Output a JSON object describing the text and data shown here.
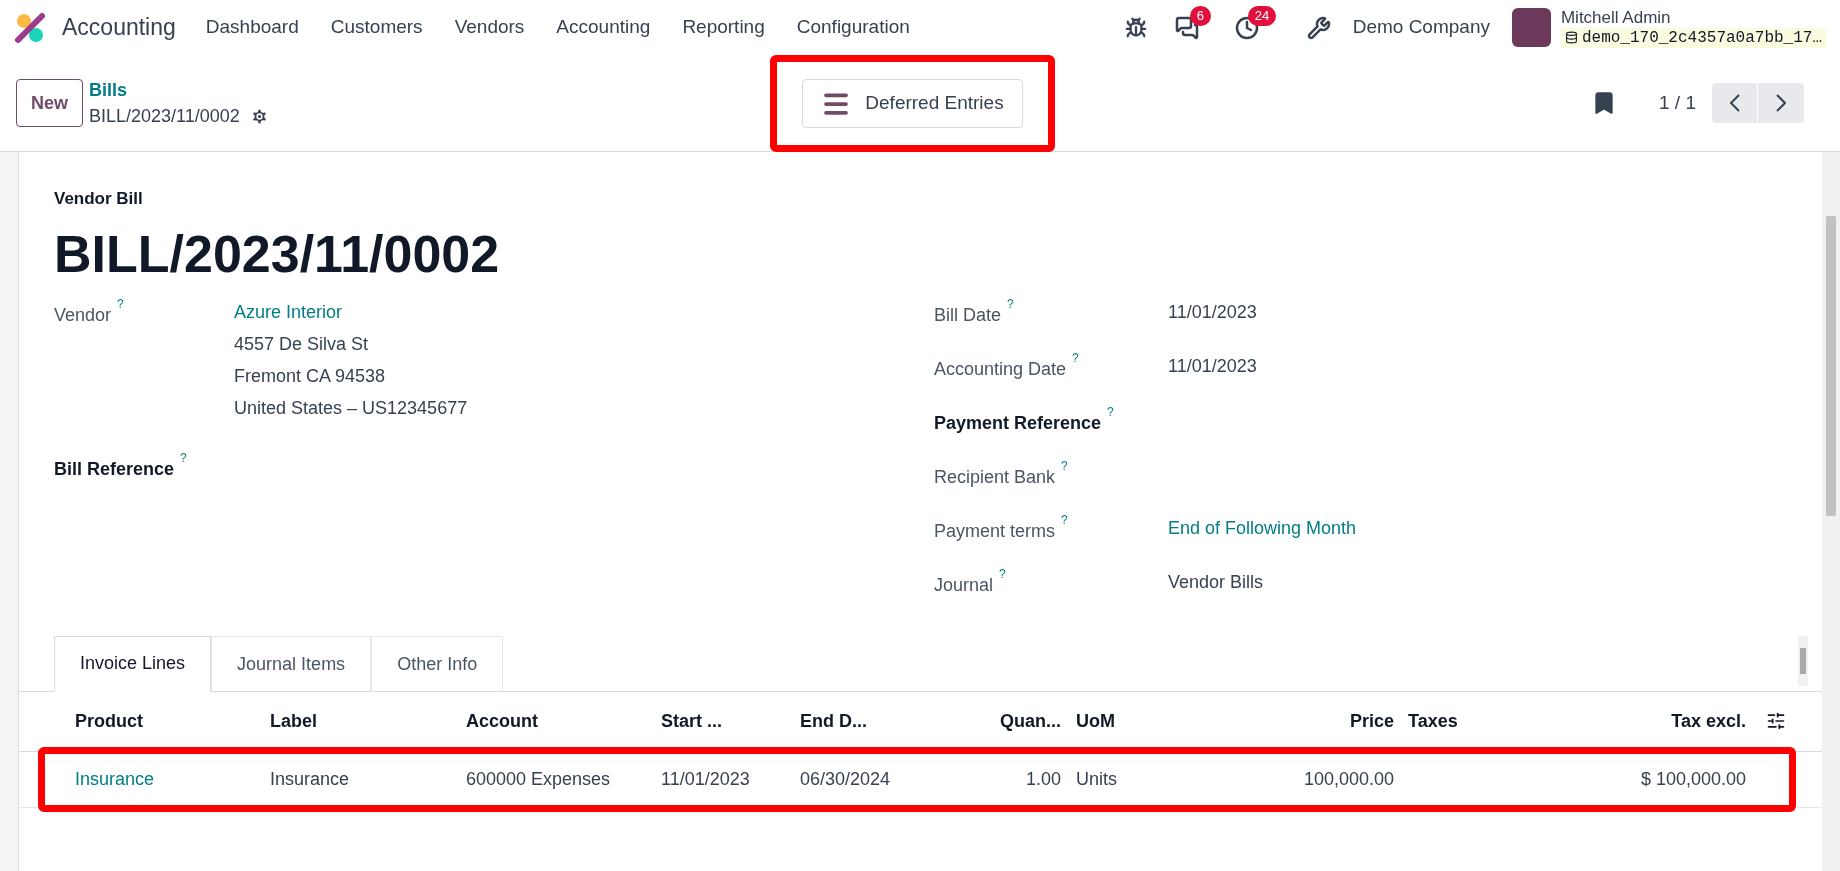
{
  "navbar": {
    "app_name": "Accounting",
    "menu": [
      "Dashboard",
      "Customers",
      "Vendors",
      "Accounting",
      "Reporting",
      "Configuration"
    ],
    "messages_count": "6",
    "activities_count": "24",
    "company": "Demo Company",
    "user_name": "Mitchell Admin",
    "database": "demo_170_2c4357a0a7bb_17…"
  },
  "control_panel": {
    "new_button": "New",
    "breadcrumb": "Bills",
    "record_name": "BILL/2023/11/0002",
    "action_button": {
      "label": "Deferred Entries",
      "highlighted": true
    },
    "pager": "1 / 1"
  },
  "form": {
    "subtitle": "Vendor Bill",
    "title": "BILL/2023/11/0002",
    "left_fields": [
      {
        "label": "Vendor",
        "help": "?",
        "bold": false,
        "kind": "link",
        "value": "Azure Interior",
        "lines": [
          "4557 De Silva St",
          "Fremont CA 94538",
          "United States – US12345677"
        ]
      },
      {
        "label": "Bill Reference",
        "help": "?",
        "bold": true,
        "kind": "empty"
      }
    ],
    "right_fields": [
      {
        "label": "Bill Date",
        "help": "?",
        "bold": false,
        "kind": "text",
        "value": "11/01/2023"
      },
      {
        "label": "Accounting Date",
        "help": "?",
        "bold": false,
        "kind": "text",
        "value": "11/01/2023"
      },
      {
        "label": "Payment Reference",
        "help": "?",
        "bold": true,
        "kind": "empty"
      },
      {
        "label": "Recipient Bank",
        "help": "?",
        "bold": false,
        "kind": "empty"
      },
      {
        "label": "Payment terms",
        "help": "?",
        "bold": false,
        "kind": "link",
        "value": "End of Following Month"
      },
      {
        "label": "Journal",
        "help": "?",
        "bold": false,
        "kind": "text",
        "value": "Vendor Bills"
      }
    ],
    "tabs": [
      {
        "label": "Invoice Lines",
        "selected": true
      },
      {
        "label": "Journal Items",
        "selected": false
      },
      {
        "label": "Other Info",
        "selected": false
      }
    ],
    "table": {
      "columns": [
        "Product",
        "Label",
        "Account",
        "Start ...",
        "End D...",
        "Quan...",
        "UoM",
        "Price",
        "Taxes",
        "Tax excl."
      ],
      "rows": [
        {
          "highlighted": true,
          "cells": [
            "Insurance",
            "Insurance",
            "600000 Expenses",
            "11/01/2023",
            "06/30/2024",
            "1.00",
            "Units",
            "100,000.00",
            "",
            "$ 100,000.00"
          ]
        }
      ]
    }
  }
}
